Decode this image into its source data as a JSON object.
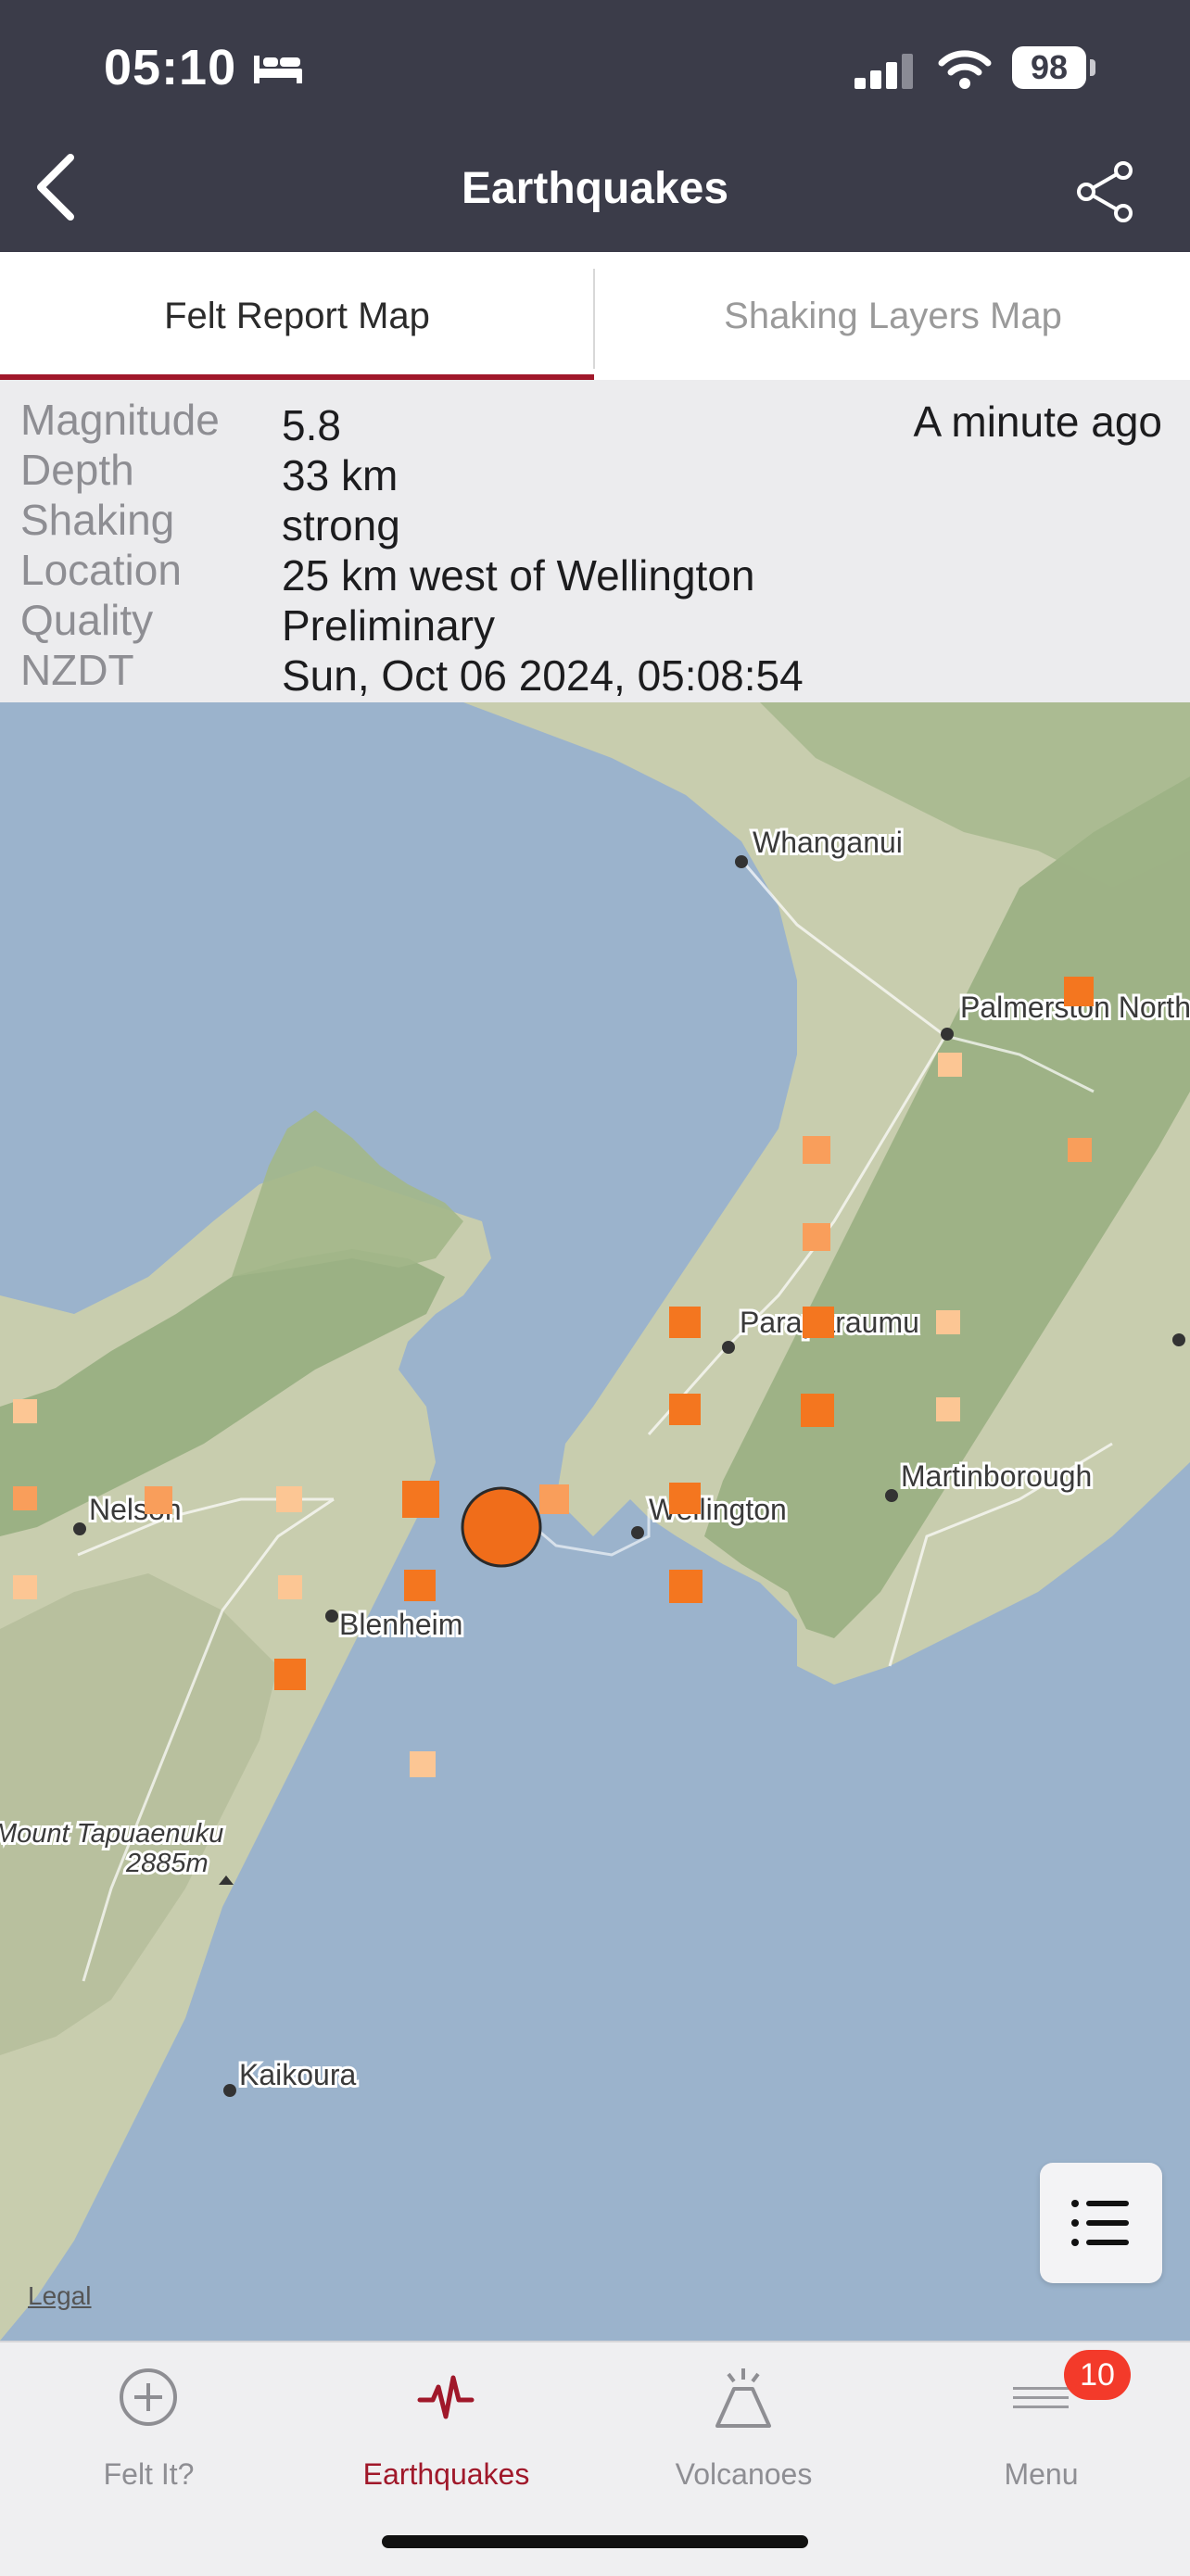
{
  "status_bar": {
    "time": "05:10",
    "battery": "98",
    "icons": [
      "bed-icon",
      "signal-icon",
      "wifi-icon",
      "battery-icon"
    ]
  },
  "nav": {
    "title": "Earthquakes",
    "back_icon": "chevron-left-icon",
    "share_icon": "share-icon"
  },
  "tabs": [
    {
      "label": "Felt Report Map",
      "selected": true
    },
    {
      "label": "Shaking Layers Map",
      "selected": false
    }
  ],
  "quake": {
    "time_ago": "A minute ago",
    "rows": [
      {
        "label": "Magnitude",
        "value": "5.8"
      },
      {
        "label": "Depth",
        "value": "33 km"
      },
      {
        "label": "Shaking",
        "value": "strong"
      },
      {
        "label": "Location",
        "value": "25 km west of Wellington"
      },
      {
        "label": "Quality",
        "value": "Preliminary"
      },
      {
        "label": "NZDT",
        "value": "Sun, Oct 06 2024, 05:08:54"
      }
    ]
  },
  "map": {
    "places": [
      "Whanganui",
      "Palmerston North",
      "Paraparaumu",
      "Wellington",
      "Martinborough",
      "Nelson",
      "Blenheim",
      "Mount Tapuaenuku",
      "2885m",
      "Kaikoura"
    ],
    "legal": "Legal",
    "colors": {
      "sea": "#9bb3cc",
      "land": "#c9ceb0",
      "forest": "#8fa878",
      "epicenter": "#f06d1a",
      "report_strong": "#f4761f",
      "report_medium": "#f99e5b",
      "report_light": "#fcc694"
    }
  },
  "tab_bar": {
    "items": [
      {
        "label": "Felt It?",
        "icon": "plus-circle-icon",
        "selected": false
      },
      {
        "label": "Earthquakes",
        "icon": "pulse-icon",
        "selected": true
      },
      {
        "label": "Volcanoes",
        "icon": "volcano-icon",
        "selected": false
      },
      {
        "label": "Menu",
        "icon": "menu-icon",
        "selected": false
      }
    ],
    "menu_badge": "10"
  }
}
